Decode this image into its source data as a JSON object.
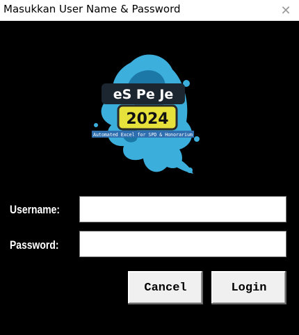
{
  "window": {
    "title": "Masukkan User Name & Password",
    "close_icon": "close-icon"
  },
  "logo": {
    "title": "eS Pe Je",
    "year": "2024",
    "tagline": "Automated Excel for SPD & Honorarium",
    "colors": {
      "splash": "#3fb8e8",
      "badge": "#1c2630",
      "year_bg": "#e7e23b",
      "tagline_bg": "#2f6fb0"
    }
  },
  "form": {
    "username_label": "Username:",
    "username_value": "",
    "password_label": "Password:",
    "password_value": ""
  },
  "buttons": {
    "cancel": "Cancel",
    "login": "Login"
  }
}
